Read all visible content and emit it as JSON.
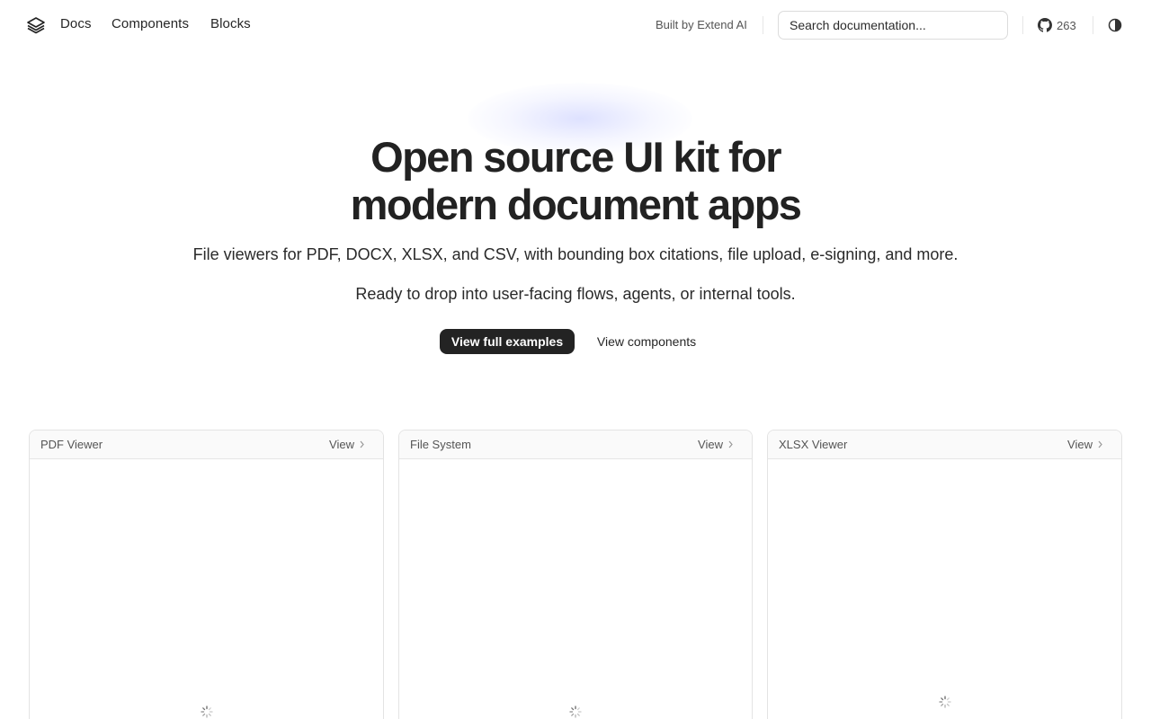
{
  "header": {
    "logo_icon": "layers-icon",
    "nav": [
      {
        "label": "Docs"
      },
      {
        "label": "Components"
      },
      {
        "label": "Blocks"
      }
    ],
    "built_by": "Built by Extend AI",
    "search": {
      "placeholder": "Search documentation..."
    },
    "github": {
      "icon": "github-icon",
      "count": "263"
    },
    "theme_icon": "contrast-icon"
  },
  "hero": {
    "title_line1": "Open source UI kit for",
    "title_line2": "modern document apps",
    "subtitle1": "File viewers for PDF, DOCX, XLSX, and CSV, with bounding box citations, file upload, e-signing, and more.",
    "subtitle2": "Ready to drop into user-facing flows, agents, or internal tools.",
    "primary_button": "View full examples",
    "secondary_button": "View components"
  },
  "cards": [
    {
      "title": "PDF Viewer",
      "view_label": "View",
      "state": "loading"
    },
    {
      "title": "File System",
      "view_label": "View",
      "state": "loading"
    },
    {
      "title": "XLSX Viewer",
      "view_label": "View",
      "state": "loading"
    }
  ],
  "colors": {
    "primary_button_bg": "#232323",
    "text": "#1f1f1f",
    "muted": "#555555",
    "border": "#e3e3e3"
  }
}
